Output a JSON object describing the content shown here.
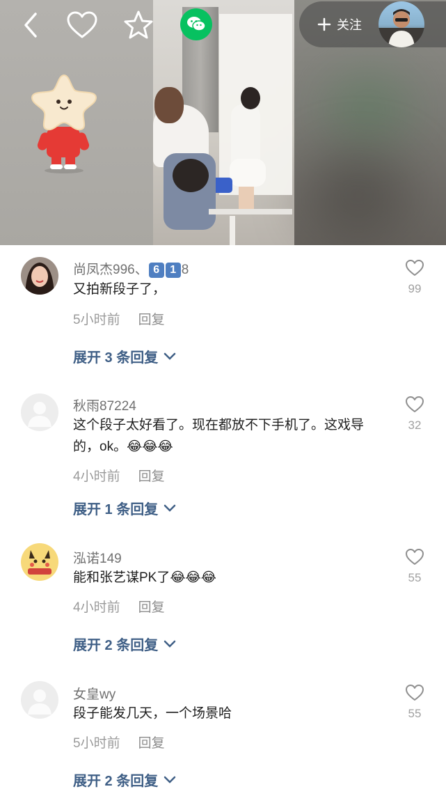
{
  "video": {
    "follow_label": "关注"
  },
  "comments": [
    {
      "user_prefix": "尚凤杰996、",
      "user_badges": [
        "6",
        "1"
      ],
      "user_suffix": "8",
      "text": "又拍新段子了，",
      "time": "5小时前",
      "reply_label": "回复",
      "likes": "99",
      "expand_label": "展开 3 条回复"
    },
    {
      "user": "秋雨87224",
      "text": "这个段子太好看了。现在都放不下手机了。这戏导的，ok。",
      "emojis": "😂😂😂",
      "time": "4小时前",
      "reply_label": "回复",
      "likes": "32",
      "expand_label": "展开 1 条回复"
    },
    {
      "user": "泓诺149",
      "text": "能和张艺谋PK了",
      "emojis": "😂😂😂",
      "time": "4小时前",
      "reply_label": "回复",
      "likes": "55",
      "expand_label": "展开 2 条回复"
    },
    {
      "user": "女皇wy",
      "text": "段子能发几天，一个场景哈",
      "time": "5小时前",
      "reply_label": "回复",
      "likes": "55",
      "expand_label": "展开 2 条回复"
    }
  ],
  "icons": {
    "back": "chevron-left-icon",
    "favorite": "heart-outline-icon",
    "collect": "star-outline-icon",
    "share": "wechat-icon",
    "follow": "plus-icon",
    "like": "heart-outline-icon",
    "expand": "chevron-down-icon"
  },
  "colors": {
    "wechat_green": "#07c160",
    "expand_blue": "#3f5f86",
    "muted_gray": "#9a9a9a"
  }
}
